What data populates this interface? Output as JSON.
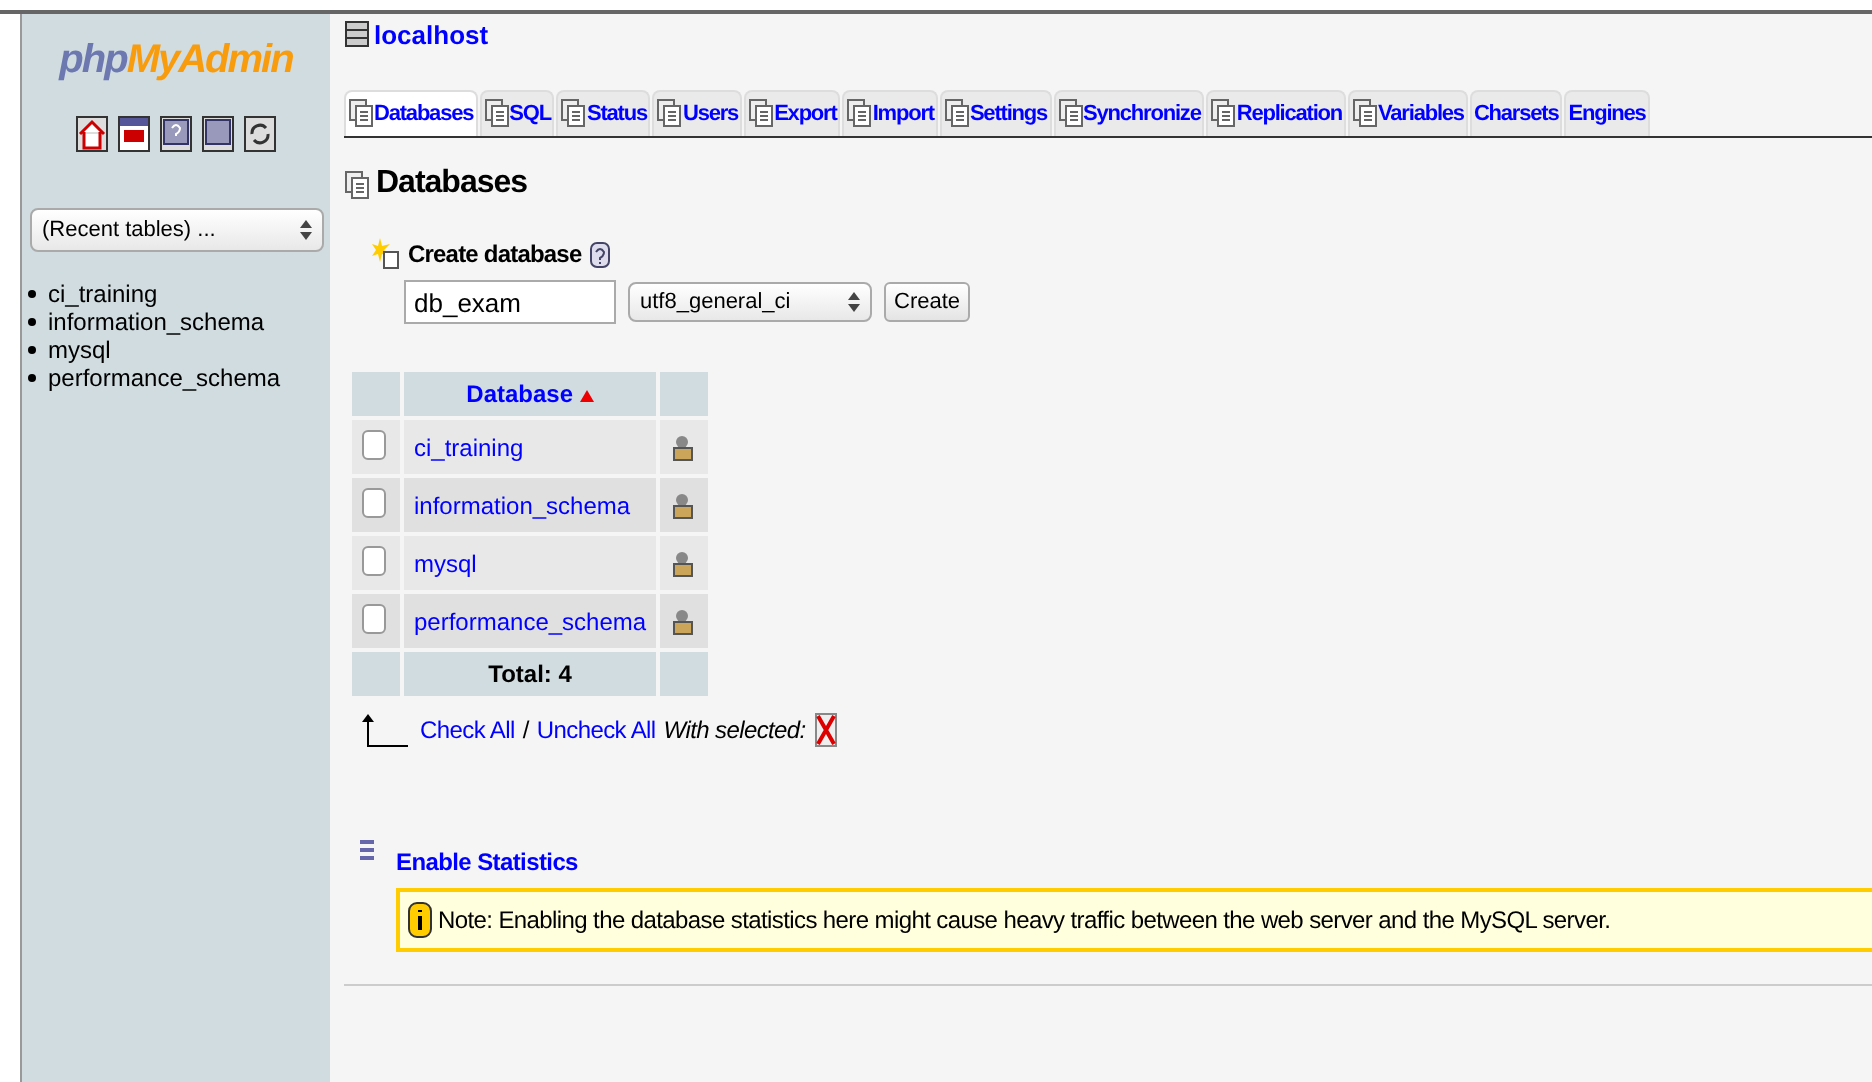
{
  "sidebar": {
    "logo": {
      "first": "php",
      "second": "MyAdmin"
    },
    "recent_tables": "(Recent tables) ...",
    "databases": [
      "ci_training",
      "information_schema",
      "mysql",
      "performance_schema"
    ]
  },
  "breadcrumb": "localhost",
  "tabs": [
    {
      "label": "Databases",
      "selected": true
    },
    {
      "label": "SQL",
      "selected": false
    },
    {
      "label": "Status",
      "selected": false
    },
    {
      "label": "Users",
      "selected": false
    },
    {
      "label": "Export",
      "selected": false
    },
    {
      "label": "Import",
      "selected": false
    },
    {
      "label": "Settings",
      "selected": false
    },
    {
      "label": "Synchronize",
      "selected": false
    },
    {
      "label": "Replication",
      "selected": false
    },
    {
      "label": "Variables",
      "selected": false
    },
    {
      "label": "Charsets",
      "selected": false
    },
    {
      "label": "Engines",
      "selected": false
    }
  ],
  "heading": "Databases",
  "create": {
    "title": "Create database",
    "name_value": "db_exam",
    "collation": "utf8_general_ci",
    "button": "Create"
  },
  "table": {
    "column": "Database",
    "rows": [
      {
        "name": "ci_training",
        "checked": false
      },
      {
        "name": "information_schema",
        "checked": false
      },
      {
        "name": "mysql",
        "checked": false
      },
      {
        "name": "performance_schema",
        "checked": false
      }
    ],
    "total": "Total: 4"
  },
  "actions": {
    "check_all": "Check All",
    "separator": "/",
    "uncheck_all": "Uncheck All",
    "with_selected": "With selected:"
  },
  "statistics": {
    "link": "Enable Statistics",
    "note": "Note: Enabling the database statistics here might cause heavy traffic between the web server and the MySQL server."
  }
}
